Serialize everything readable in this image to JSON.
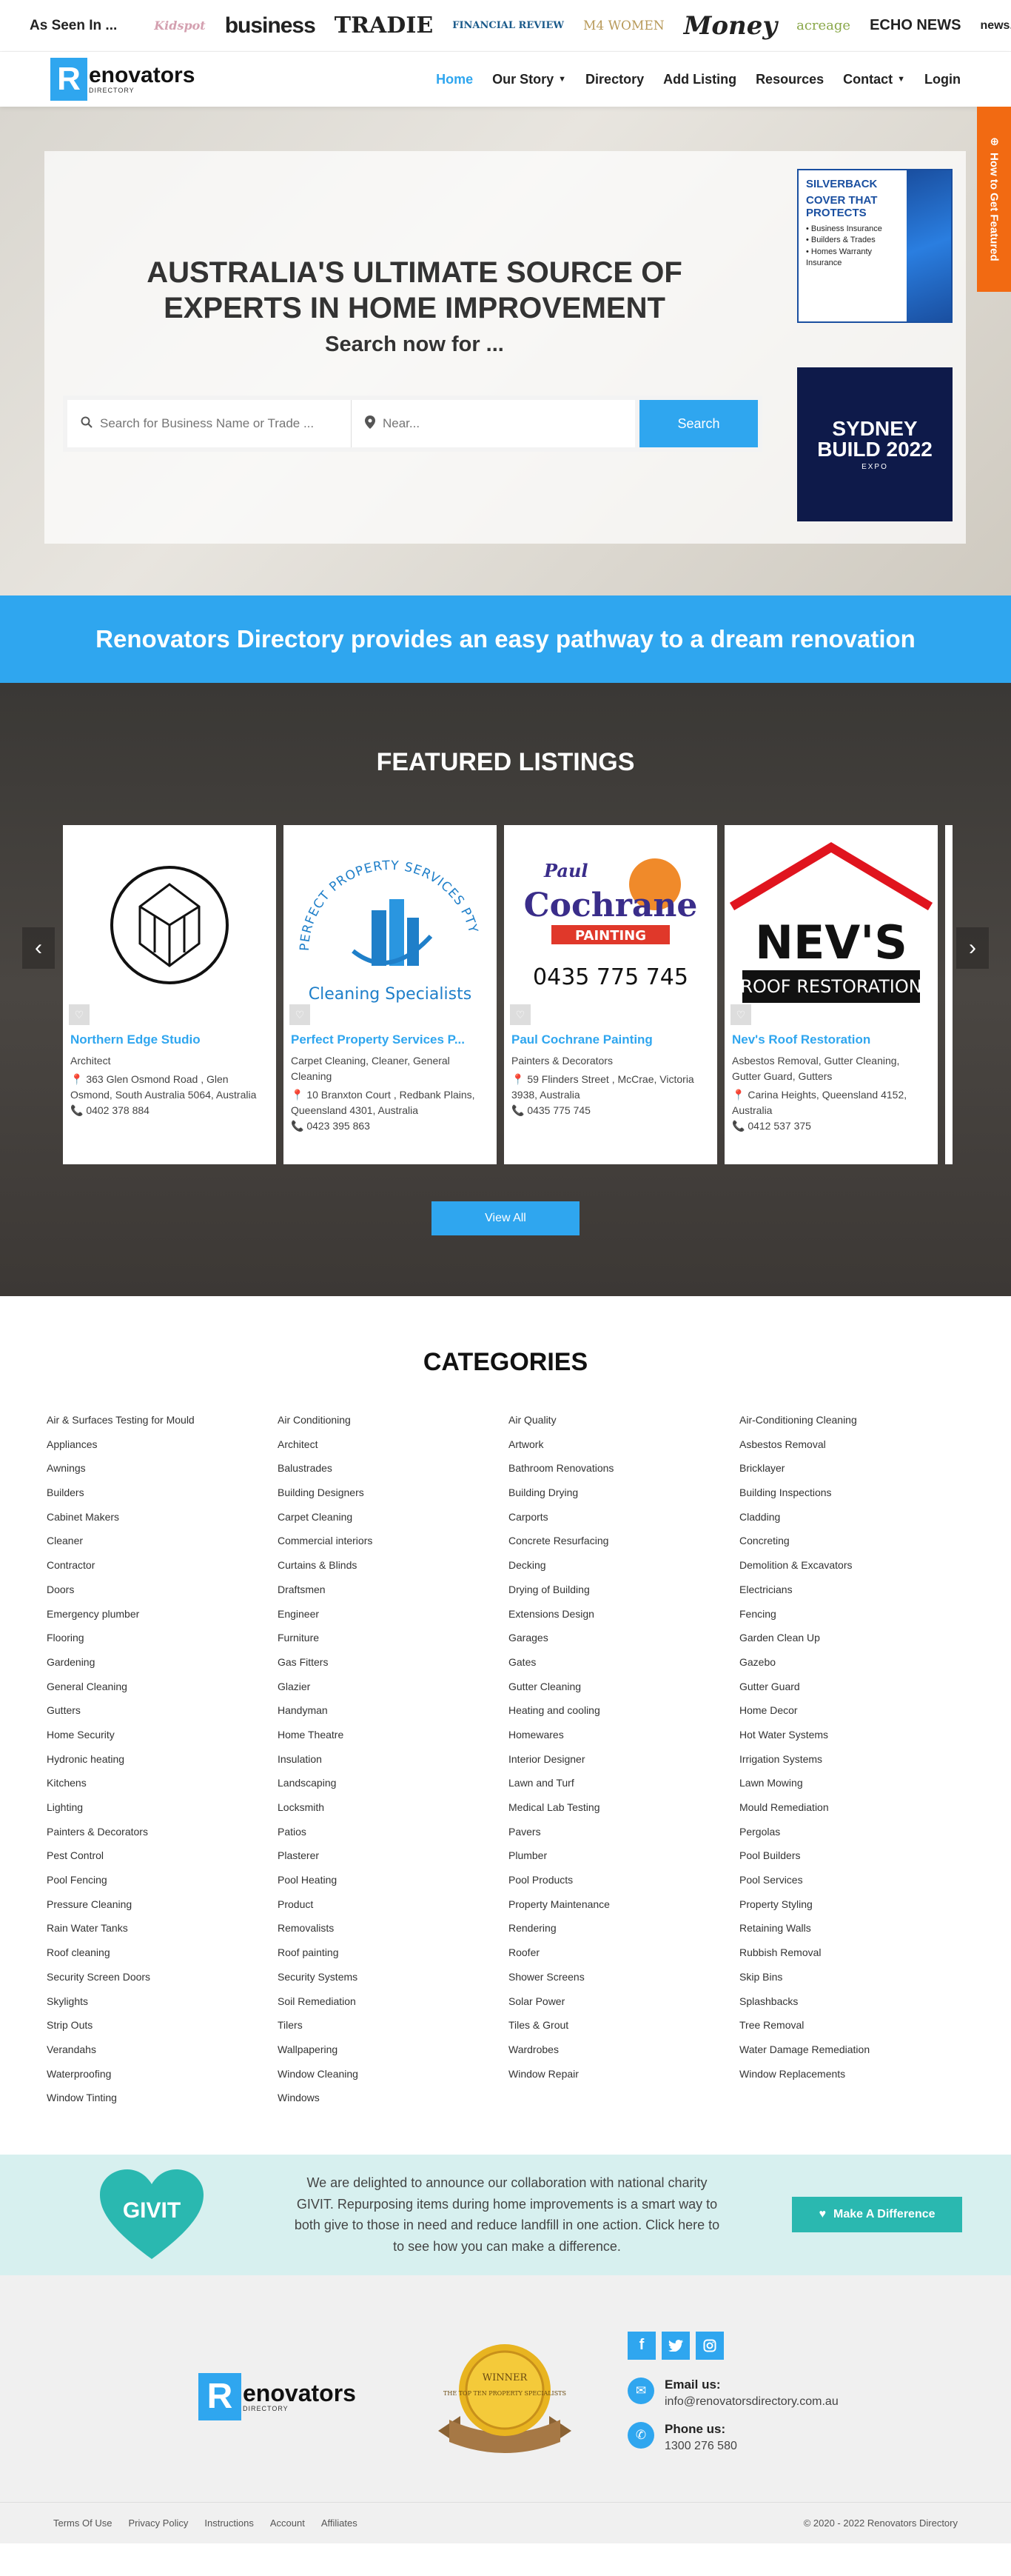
{
  "seen": {
    "label": "As Seen In ...",
    "logos": [
      "Kidspot",
      "business",
      "TRADIE",
      "FINANCIAL REVIEW",
      "M4 WOMEN",
      "Money",
      "acreage",
      "ECHO NEWS",
      "news.com.au"
    ]
  },
  "nav": {
    "brand_letter": "R",
    "brand_name": "enovators",
    "brand_sub": "DIRECTORY",
    "links": [
      "Home",
      "Our Story",
      "Directory",
      "Add Listing",
      "Resources",
      "Contact",
      "Login"
    ]
  },
  "hero": {
    "title": "AUSTRALIA'S ULTIMATE SOURCE OF EXPERTS IN HOME IMPROVEMENT",
    "subtitle": "Search now for ...",
    "search_placeholder": "Search for Business Name or Trade ...",
    "near_placeholder": "Near...",
    "search_button": "Search",
    "side_tab": "How to Get Featured",
    "ad1": {
      "brand": "SILVERBACK",
      "headline": "COVER THAT PROTECTS",
      "items": [
        "• Business Insurance",
        "• Builders & Trades",
        "• Homes Warranty Insurance"
      ]
    },
    "ad2": {
      "title": "SYDNEY BUILD 2022",
      "sub": "EXPO"
    }
  },
  "banner": {
    "text": "Renovators Directory provides an easy pathway to a dream renovation"
  },
  "featured": {
    "title": "FEATURED LISTINGS",
    "view_all": "View All",
    "cards": [
      {
        "name": "Northern Edge Studio",
        "category": "Architect",
        "address": "363 Glen Osmond Road , Glen Osmond, South Australia 5064, Australia",
        "phone": "0402 378 884"
      },
      {
        "name": "Perfect Property Services P...",
        "category": "Carpet Cleaning, Cleaner, General Cleaning",
        "address": "10 Branxton Court , Redbank Plains, Queensland 4301, Australia",
        "phone": "0423 395 863",
        "logo_arc": "PERFECT PROPERTY SERVICES PTY",
        "logo_sub": "Cleaning Specialists"
      },
      {
        "name": "Paul Cochrane Painting",
        "category": "Painters & Decorators",
        "address": "59 Flinders Street , McCrae, Victoria 3938, Australia",
        "phone": "0435 775 745",
        "logo_top": "Paul",
        "logo_main": "Cochrane",
        "logo_band": "PAINTING",
        "logo_phone": "0435 775 745"
      },
      {
        "name": "Nev's Roof Restoration",
        "category": "Asbestos Removal, Gutter Cleaning, Gutter Guard, Gutters",
        "address": "Carina Heights, Queensland 4152, Australia",
        "phone": "0412 537 375",
        "logo_main": "NEV'S",
        "logo_band": "ROOF RESTORATION"
      }
    ]
  },
  "categories": {
    "title": "CATEGORIES",
    "columns": [
      [
        "Air & Surfaces Testing for Mould",
        "Appliances",
        "Awnings",
        "Builders",
        "Cabinet Makers",
        "Cleaner",
        "Contractor",
        "Doors",
        "Emergency plumber",
        "Flooring",
        "Gardening",
        "General Cleaning",
        "Gutters",
        "Home Security",
        "Hydronic heating",
        "Kitchens",
        "Lighting",
        "Painters & Decorators",
        "Pest Control",
        "Pool Fencing",
        "Pressure Cleaning",
        "Rain Water Tanks",
        "Roof cleaning",
        "Security Screen Doors",
        "Skylights",
        "Strip Outs",
        "Verandahs",
        "Waterproofing",
        "Window Tinting"
      ],
      [
        "Air Conditioning",
        "Architect",
        "Balustrades",
        "Building Designers",
        "Carpet Cleaning",
        "Commercial interiors",
        "Curtains & Blinds",
        "Draftsmen",
        "Engineer",
        "Furniture",
        "Gas Fitters",
        "Glazier",
        "Handyman",
        "Home Theatre",
        "Insulation",
        "Landscaping",
        "Locksmith",
        "Patios",
        "Plasterer",
        "Pool Heating",
        "Product",
        "Removalists",
        "Roof painting",
        "Security Systems",
        "Soil Remediation",
        "Tilers",
        "Wallpapering",
        "Window Cleaning",
        "Windows"
      ],
      [
        "Air Quality",
        "Artwork",
        "Bathroom Renovations",
        "Building Drying",
        "Carports",
        "Concrete Resurfacing",
        "Decking",
        "Drying of Building",
        "Extensions Design",
        "Garages",
        "Gates",
        "Gutter Cleaning",
        "Heating and cooling",
        "Homewares",
        "Interior Designer",
        "Lawn and Turf",
        "Medical Lab Testing",
        "Pavers",
        "Plumber",
        "Pool Products",
        "Property Maintenance",
        "Rendering",
        "Roofer",
        "Shower Screens",
        "Solar Power",
        "Tiles & Grout",
        "Wardrobes",
        "Window Repair"
      ],
      [
        "Air-Conditioning Cleaning",
        "Asbestos Removal",
        "Bricklayer",
        "Building Inspections",
        "Cladding",
        "Concreting",
        "Demolition & Excavators",
        "Electricians",
        "Fencing",
        "Garden Clean Up",
        "Gazebo",
        "Gutter Guard",
        "Home Decor",
        "Hot Water Systems",
        "Irrigation Systems",
        "Lawn Mowing",
        "Mould Remediation",
        "Pergolas",
        "Pool Builders",
        "Pool Services",
        "Property Styling",
        "Retaining Walls",
        "Rubbish Removal",
        "Skip Bins",
        "Splashbacks",
        "Tree Removal",
        "Water Damage Remediation",
        "Window Replacements"
      ]
    ]
  },
  "givit": {
    "logo": "GIVIT",
    "text": "We are delighted to announce our collaboration with national charity GIVIT. Repurposing items during home improvements is a smart way to both give to those in need and reduce landfill in one action. Click here to to see how you can make a difference.",
    "button": "Make A Difference"
  },
  "footer": {
    "badge_top": "WINNER",
    "badge_text": "THE TOP TEN PROPERTY SPECIALISTS",
    "email_label": "Email us:",
    "email": "info@renovatorsdirectory.com.au",
    "phone_label": "Phone us:",
    "phone": "1300 276 580",
    "links": [
      "Terms Of Use",
      "Privacy Policy",
      "Instructions",
      "Account",
      "Affiliates"
    ],
    "copyright": "© 2020 - 2022 Renovators Directory"
  }
}
